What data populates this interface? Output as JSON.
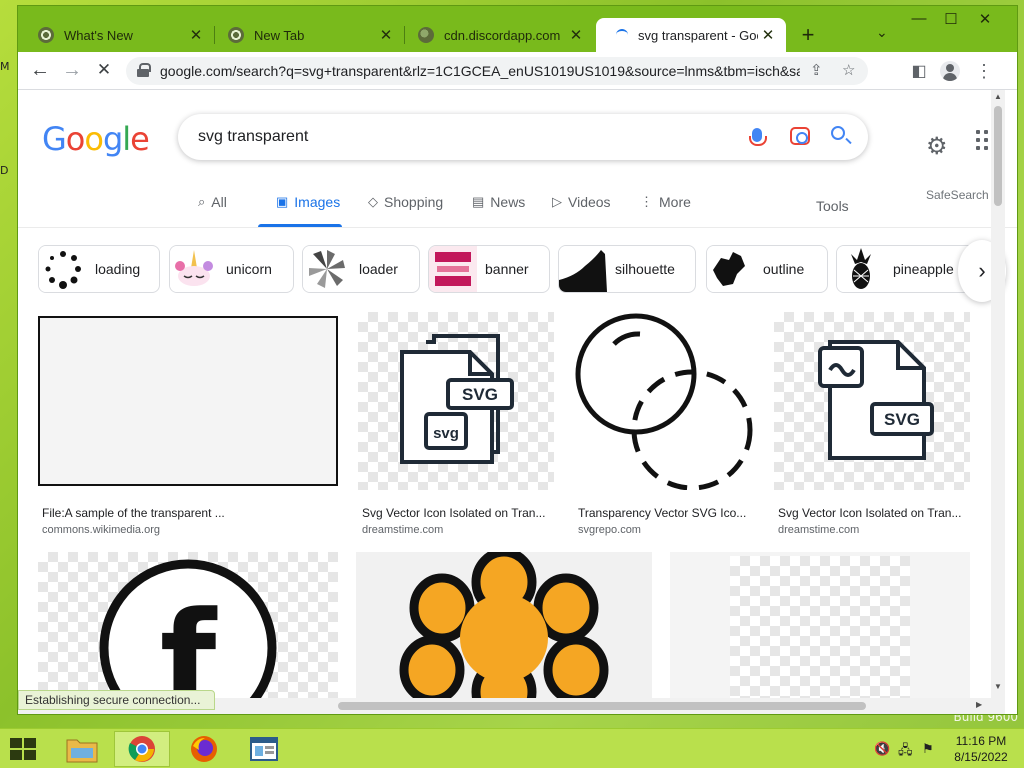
{
  "desktop": {
    "left_text_1": "M",
    "left_text_2": "D",
    "watermark": "Build 9600"
  },
  "browser": {
    "tabs": [
      {
        "title": "What's New",
        "favicon": "chrome-icon",
        "active": false
      },
      {
        "title": "New Tab",
        "favicon": "chrome-icon",
        "active": false
      },
      {
        "title": "cdn.discordapp.com",
        "favicon": "globe-icon",
        "active": false
      },
      {
        "title": "svg transparent - Goog",
        "favicon": "loading-spinner-icon",
        "active": true
      }
    ],
    "new_tab_symbol": "+",
    "tab_search_symbol": "⌄",
    "window_controls": {
      "minimize": "—",
      "maximize": "☐",
      "close": "✕"
    },
    "toolbar": {
      "back": "←",
      "forward": "→",
      "stop": "✕",
      "url": "google.com/search?q=svg+transparent&rlz=1C1GCEA_enUS1019US1019&source=lnms&tbm=isch&sa=X...",
      "share_icon": "⇪",
      "bookmark_icon": "☆",
      "sidepanel_icon": "◧",
      "menu_icon": "⋮"
    },
    "status_text": "Establishing secure connection..."
  },
  "google": {
    "logo_letters": [
      "G",
      "o",
      "o",
      "g",
      "l",
      "e"
    ],
    "search_query": "svg transparent",
    "settings_icon": "⚙",
    "nav_tabs": [
      {
        "label": "All",
        "icon": "⌕",
        "active": false
      },
      {
        "label": "Images",
        "icon": "▣",
        "active": true
      },
      {
        "label": "Shopping",
        "icon": "◇",
        "active": false
      },
      {
        "label": "News",
        "icon": "▤",
        "active": false
      },
      {
        "label": "Videos",
        "icon": "▷",
        "active": false
      },
      {
        "label": "More",
        "icon": "⋮",
        "active": false
      }
    ],
    "tools_label": "Tools",
    "safesearch_label": "SafeSearch",
    "chips": [
      {
        "label": "loading"
      },
      {
        "label": "unicorn"
      },
      {
        "label": "loader"
      },
      {
        "label": "banner"
      },
      {
        "label": "silhouette"
      },
      {
        "label": "outline"
      },
      {
        "label": "pineapple"
      }
    ],
    "chip_next": "›",
    "results": [
      {
        "title": "File:A sample of the transparent ...",
        "source": "commons.wikimedia.org"
      },
      {
        "title": "Svg Vector Icon Isolated on Tran...",
        "source": "dreamstime.com"
      },
      {
        "title": "Transparency Vector SVG Ico...",
        "source": "svgrepo.com"
      },
      {
        "title": "Svg Vector Icon Isolated on Tran...",
        "source": "dreamstime.com"
      }
    ],
    "svg_badge_text": "SVG",
    "svg_small_text": "svg",
    "facebook_letter": "f"
  },
  "taskbar": {
    "time": "11:16 PM",
    "date": "8/15/2022"
  },
  "colors": {
    "accent": "#1a73e8",
    "desktop_green": "#93c53c",
    "window_frame": "#79ba1c",
    "aol_orange": "#f5a623"
  }
}
